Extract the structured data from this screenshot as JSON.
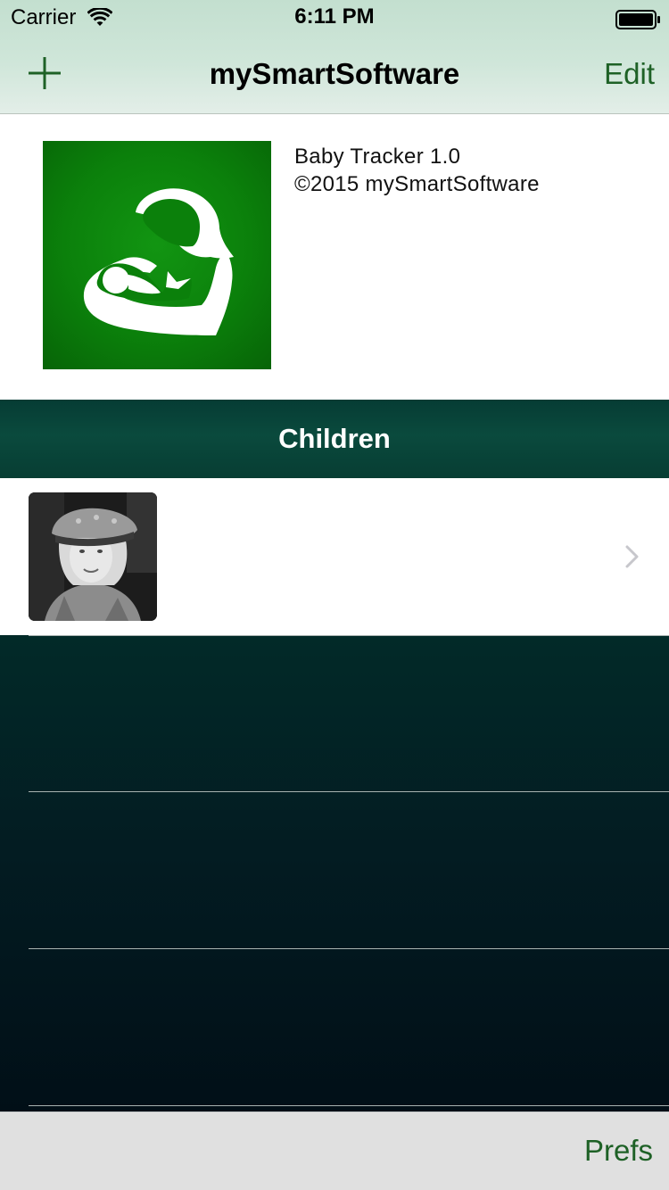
{
  "status_bar": {
    "carrier": "Carrier",
    "time": "6:11 PM",
    "icons": [
      "wifi-icon",
      "battery-icon"
    ]
  },
  "nav_bar": {
    "add_icon": "plus-icon",
    "title": "mySmartSoftware",
    "edit_label": "Edit"
  },
  "about": {
    "app_icon": "breastfeeding-mother-icon",
    "app_name": "Baby Tracker 1.0",
    "copyright": "©2015 mySmartSoftware"
  },
  "children_section": {
    "title": "Children",
    "items": [
      {
        "name": "",
        "photo": "child-photo",
        "accessory": "chevron-right-icon"
      }
    ]
  },
  "toolbar": {
    "prefs_label": "Prefs"
  },
  "colors": {
    "accent": "#1e6126",
    "nav_bar_bg": "#c8e2d4",
    "section_header_bg": "#0a4a3d",
    "icon_green": "#0b800b",
    "toolbar_bg": "#e0e0e0"
  }
}
